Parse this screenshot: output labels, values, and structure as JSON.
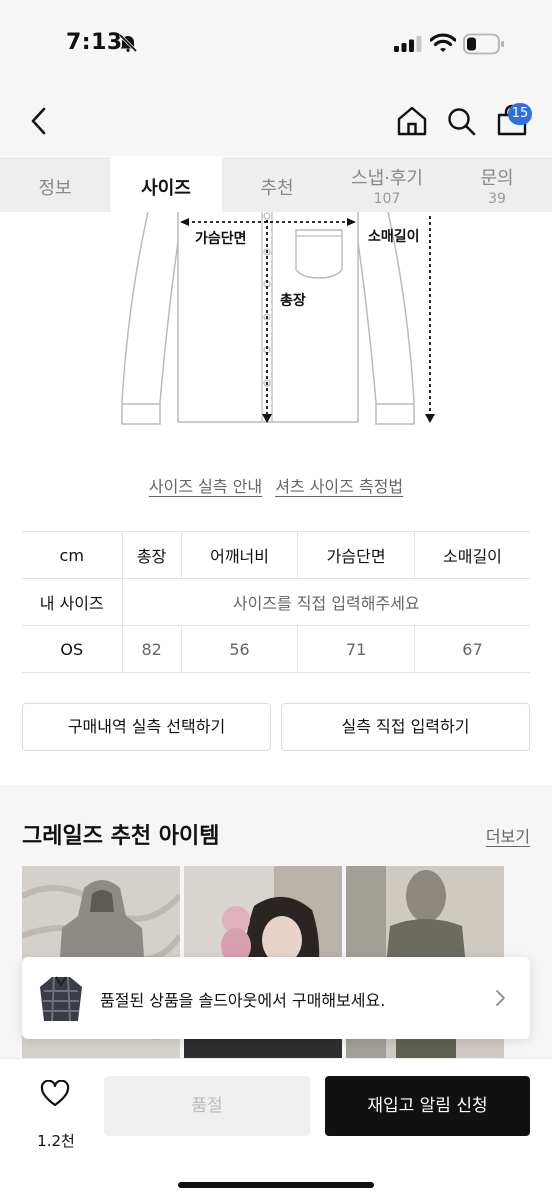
{
  "status_bar": {
    "time": "7:13",
    "battery_level": 0.25
  },
  "header": {
    "cart_count": "15"
  },
  "tabs": [
    {
      "label": "정보",
      "count": ""
    },
    {
      "label": "사이즈",
      "count": ""
    },
    {
      "label": "추천",
      "count": ""
    },
    {
      "label": "스냅·후기",
      "count": "107"
    },
    {
      "label": "문의",
      "count": "39"
    }
  ],
  "active_tab": "사이즈",
  "diagram": {
    "chest_label": "가슴단면",
    "sleeve_label": "소매길이",
    "length_label": "총장"
  },
  "links": {
    "size_guide": "사이즈 실측 안내",
    "shirt_measure": "셔츠 사이즈 측정법"
  },
  "size_table": {
    "headers": [
      "cm",
      "총장",
      "어깨너비",
      "가슴단면",
      "소매길이"
    ],
    "my_size_label": "내 사이즈",
    "my_size_prompt": "사이즈를 직접 입력해주세요",
    "rows": [
      {
        "size": "OS",
        "values": [
          "82",
          "56",
          "71",
          "67"
        ]
      }
    ]
  },
  "buttons": {
    "select_history": "구매내역 실측 선택하기",
    "direct_input": "실측 직접 입력하기"
  },
  "recommend": {
    "title": "그레일즈 추천 아이템",
    "more": "더보기"
  },
  "soldout_banner": {
    "text": "품절된 상품을 솔드아웃에서 구매해보세요."
  },
  "bottom_bar": {
    "likes": "1.2천",
    "soldout_label": "품절",
    "restock_label": "재입고 알림 신청"
  },
  "colors": {
    "accent_badge": "#2f6fe4",
    "primary_button": "#111111"
  }
}
